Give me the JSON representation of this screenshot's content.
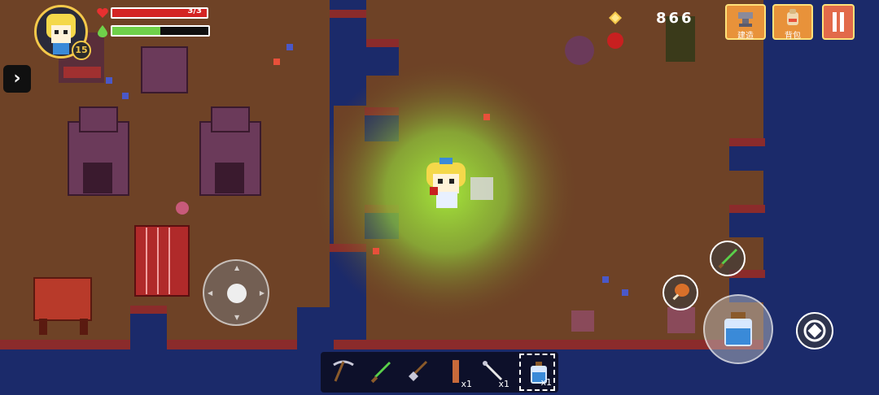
{
  "player": {
    "level": "15",
    "hp_text": "3/3",
    "hp_fraction": 1.0,
    "energy_fraction": 0.5,
    "portrait_icon": "player-portrait-icon"
  },
  "currency": {
    "coins": "866",
    "gem_icon": "gem-icon"
  },
  "menu": {
    "build_label": "建造",
    "bag_label": "背包",
    "pause_icon": "pause-icon"
  },
  "hotbar": {
    "slots": [
      {
        "icon": "pickaxe-icon",
        "qty": ""
      },
      {
        "icon": "green-sword-icon",
        "qty": ""
      },
      {
        "icon": "shovel-icon",
        "qty": ""
      },
      {
        "icon": "wood-plank-icon",
        "qty": "x1"
      },
      {
        "icon": "wand-icon",
        "qty": "x1"
      },
      {
        "icon": "water-bottle-icon",
        "qty": "x1",
        "selected": true
      }
    ]
  },
  "colors": {
    "ground": "#6e4226",
    "water": "#1b2a6a",
    "glow": "#b6e83a",
    "hud_gold": "#f4c84a",
    "menu_orange": "#e8923a",
    "hp_red": "#d42424",
    "energy_green": "#6fd14a"
  }
}
